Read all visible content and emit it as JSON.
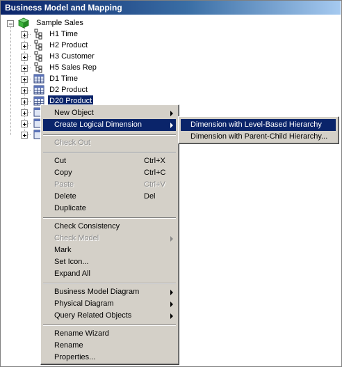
{
  "window": {
    "title": "Business Model and Mapping"
  },
  "tree": {
    "root": {
      "label": "Sample Sales",
      "icon": "business-model-cube-icon"
    },
    "children": [
      {
        "label": "H1 Time",
        "icon": "hierarchy-icon"
      },
      {
        "label": "H2 Product",
        "icon": "hierarchy-icon"
      },
      {
        "label": "H3 Customer",
        "icon": "hierarchy-icon"
      },
      {
        "label": "H5 Sales Rep",
        "icon": "hierarchy-icon"
      },
      {
        "label": "D1 Time",
        "icon": "table-icon"
      },
      {
        "label": "D2 Product",
        "icon": "table-icon"
      },
      {
        "label": "D20 Product",
        "icon": "table-icon",
        "selected": true
      }
    ]
  },
  "context_menu": {
    "items": {
      "new_object": "New Object",
      "create_logical_dimension": "Create Logical Dimension",
      "check_out": "Check Out",
      "cut": "Cut",
      "cut_shortcut": "Ctrl+X",
      "copy": "Copy",
      "copy_shortcut": "Ctrl+C",
      "paste": "Paste",
      "paste_shortcut": "Ctrl+V",
      "delete": "Delete",
      "delete_shortcut": "Del",
      "duplicate": "Duplicate",
      "check_consistency": "Check Consistency",
      "check_model": "Check Model",
      "mark": "Mark",
      "set_icon": "Set Icon...",
      "expand_all": "Expand All",
      "business_model_diagram": "Business Model Diagram",
      "physical_diagram": "Physical Diagram",
      "query_related_objects": "Query Related Objects",
      "rename_wizard": "Rename Wizard",
      "rename": "Rename",
      "properties": "Properties..."
    }
  },
  "submenu": {
    "items": {
      "level_based": "Dimension with Level-Based Hierarchy",
      "parent_child": "Dimension with Parent-Child Hierarchy..."
    }
  },
  "colors": {
    "highlight": "#0a246a",
    "menu_bg": "#d4d0c8"
  }
}
